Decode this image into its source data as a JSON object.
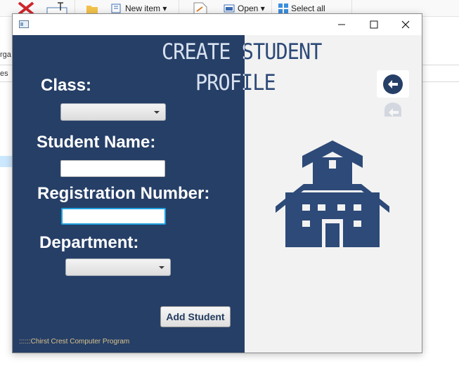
{
  "background_app": {
    "ribbon": {
      "new_item": "New item ▾",
      "open": "Open ▾",
      "select_all": "Select all"
    },
    "side_fragments": [
      "rga",
      "es"
    ]
  },
  "window": {
    "controls": {
      "minimize": "—",
      "maximize": "☐",
      "close": "✕"
    }
  },
  "form": {
    "title_line1": "CREATE STUDENT",
    "title_line2": "PROFILE",
    "class_label": "Class:",
    "class_value": "",
    "student_name_label": "Student Name:",
    "student_name_value": "",
    "registration_label": "Registration Number:",
    "registration_value": "",
    "department_label": "Department:",
    "department_value": "",
    "add_button": "Add Student",
    "footer": "::::::Chirst Crest Computer Program"
  },
  "icons": {
    "back": "arrow-left-circle-icon",
    "illustration": "school-building-icon"
  },
  "colors": {
    "panel": "#263f67",
    "accent": "#2d4a78",
    "focus": "#1ea1df",
    "footer_text": "#d9c28a"
  }
}
